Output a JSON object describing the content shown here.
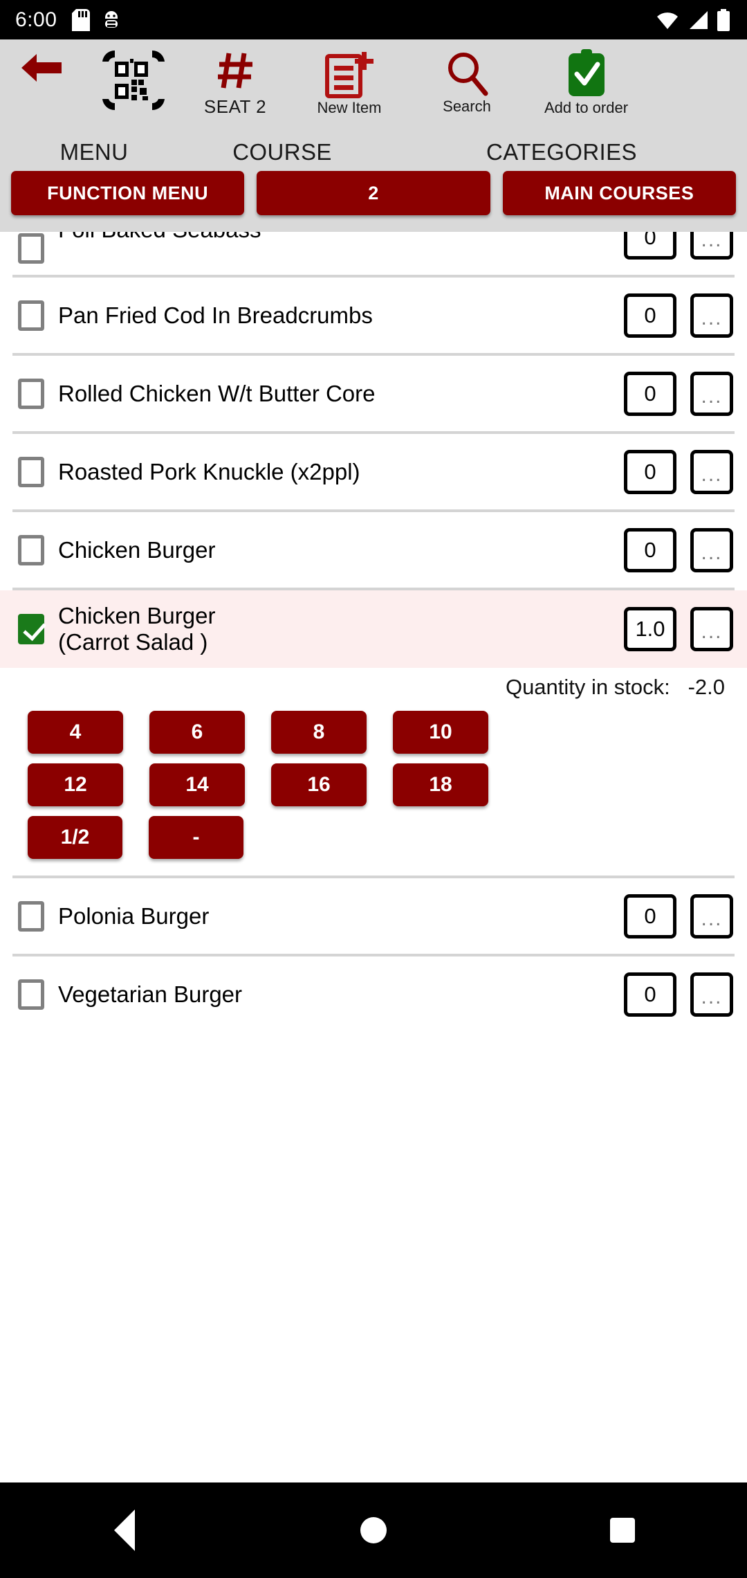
{
  "status_bar": {
    "time": "6:00",
    "left_icons": [
      "sd-card-icon",
      "usb-debug-icon"
    ],
    "right_icons": [
      "wifi-icon",
      "cell-signal-icon",
      "battery-icon"
    ]
  },
  "toolbar": {
    "back_label": "",
    "items": [
      {
        "name": "back-button",
        "icon": "arrow-left-icon",
        "label": ""
      },
      {
        "name": "qr-scan-button",
        "icon": "qr-code-icon",
        "label": ""
      },
      {
        "name": "seat-button",
        "icon": "hash-icon",
        "label": "SEAT 2"
      },
      {
        "name": "new-item-button",
        "icon": "new-document-icon",
        "label": "New Item"
      },
      {
        "name": "search-button",
        "icon": "search-icon",
        "label": "Search"
      },
      {
        "name": "add-to-order-button",
        "icon": "clipboard-check-icon",
        "label": "Add to order"
      }
    ]
  },
  "tabs": {
    "headers": [
      "MENU",
      "COURSE",
      "CATEGORIES"
    ],
    "selectors": [
      {
        "name": "menu-selector",
        "label": "FUNCTION MENU"
      },
      {
        "name": "course-selector",
        "label": "2"
      },
      {
        "name": "categories-selector",
        "label": "MAIN COURSES"
      }
    ]
  },
  "list": {
    "items": [
      {
        "name": "Foil Baked Seabass",
        "name2": "",
        "qty": "0",
        "checked": false,
        "clipped": true
      },
      {
        "name": "Pan Fried Cod In Breadcrumbs",
        "name2": "",
        "qty": "0",
        "checked": false
      },
      {
        "name": "Rolled Chicken W/t Butter Core",
        "name2": "",
        "qty": "0",
        "checked": false
      },
      {
        "name": "Roasted Pork Knuckle (x2ppl)",
        "name2": "",
        "qty": "0",
        "checked": false
      },
      {
        "name": "Chicken Burger",
        "name2": "",
        "qty": "0",
        "checked": false
      },
      {
        "name": "Chicken Burger",
        "name2": "(Carrot Salad )",
        "qty": "1.0",
        "checked": true
      },
      {
        "name": "Polonia Burger",
        "name2": "",
        "qty": "0",
        "checked": false
      },
      {
        "name": "Vegetarian Burger",
        "name2": "",
        "qty": "0",
        "checked": false
      }
    ],
    "more_label": "..."
  },
  "keypad": {
    "stock_label": "Quantity in stock:",
    "stock_value": "-2.0",
    "row1": [
      "4",
      "6",
      "8",
      "10"
    ],
    "row2": [
      "12",
      "14",
      "16",
      "18"
    ],
    "row3": [
      "1/2",
      "-"
    ]
  },
  "navbar": {
    "back": "nav-back-icon",
    "home": "nav-home-icon",
    "recents": "nav-recents-icon"
  },
  "colors": {
    "brand_red": "#8b0000",
    "toolbar_bg": "#d9d9d9",
    "selected_row_bg": "#fdeeee",
    "check_green": "#1a7a1a"
  }
}
